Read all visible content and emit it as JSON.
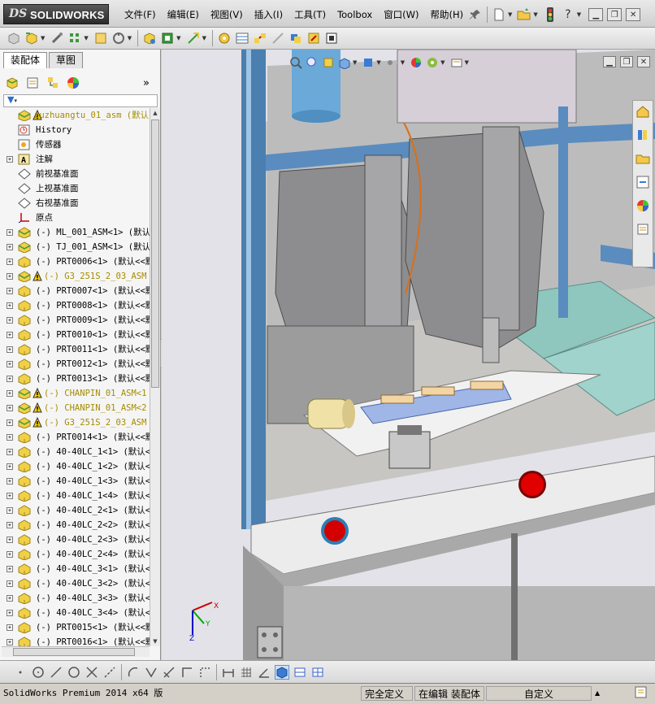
{
  "app": {
    "logo_ds": "DS",
    "logo_name": "SOLIDWORKS"
  },
  "menu": [
    "文件(F)",
    "编辑(E)",
    "视图(V)",
    "插入(I)",
    "工具(T)",
    "Toolbox",
    "窗口(W)",
    "帮助(H)"
  ],
  "panel": {
    "tabs": [
      "装配体",
      "草图"
    ],
    "tree": [
      {
        "label": "zuzhuangtu_01_asm  (默认",
        "expand": "",
        "warn": true,
        "icon": "assembly-icon",
        "top": true
      },
      {
        "label": "History",
        "expand": "",
        "icon": "history-icon"
      },
      {
        "label": "传感器",
        "expand": "",
        "icon": "sensor-icon"
      },
      {
        "label": "注解",
        "expand": "+",
        "icon": "annotation-icon"
      },
      {
        "label": "前视基准面",
        "expand": "",
        "icon": "plane-icon"
      },
      {
        "label": "上视基准面",
        "expand": "",
        "icon": "plane-icon"
      },
      {
        "label": "右视基准面",
        "expand": "",
        "icon": "plane-icon"
      },
      {
        "label": "原点",
        "expand": "",
        "icon": "origin-icon"
      },
      {
        "label": "(-) ML_001_ASM<1> (默认",
        "expand": "+",
        "icon": "subassembly-icon"
      },
      {
        "label": "(-) TJ_001_ASM<1> (默认",
        "expand": "+",
        "icon": "subassembly-icon"
      },
      {
        "label": "(-) PRT0006<1> (默认<<默",
        "expand": "+",
        "icon": "part-icon"
      },
      {
        "label": "(-) G3_251S_2_03_ASM",
        "expand": "+",
        "icon": "subassembly-icon",
        "warn": true
      },
      {
        "label": "(-) PRT0007<1> (默认<<默",
        "expand": "+",
        "icon": "part-icon"
      },
      {
        "label": "(-) PRT0008<1> (默认<<默",
        "expand": "+",
        "icon": "part-icon"
      },
      {
        "label": "(-) PRT0009<1> (默认<<默",
        "expand": "+",
        "icon": "part-icon"
      },
      {
        "label": "(-) PRT0010<1> (默认<<默",
        "expand": "+",
        "icon": "part-icon"
      },
      {
        "label": "(-) PRT0011<1> (默认<<默",
        "expand": "+",
        "icon": "part-icon"
      },
      {
        "label": "(-) PRT0012<1> (默认<<默",
        "expand": "+",
        "icon": "part-icon"
      },
      {
        "label": "(-) PRT0013<1> (默认<<默",
        "expand": "+",
        "icon": "part-icon"
      },
      {
        "label": "(-) CHANPIN_01_ASM<1",
        "expand": "+",
        "icon": "subassembly-icon",
        "warn": true
      },
      {
        "label": "(-) CHANPIN_01_ASM<2",
        "expand": "+",
        "icon": "subassembly-icon",
        "warn": true
      },
      {
        "label": "(-) G3_251S_2_03_ASM",
        "expand": "+",
        "icon": "subassembly-icon",
        "warn": true
      },
      {
        "label": "(-) PRT0014<1> (默认<<默",
        "expand": "+",
        "icon": "part-icon"
      },
      {
        "label": "(-) 40-40LC_1<1> (默认<",
        "expand": "+",
        "icon": "part-icon"
      },
      {
        "label": "(-) 40-40LC_1<2> (默认<",
        "expand": "+",
        "icon": "part-icon"
      },
      {
        "label": "(-) 40-40LC_1<3> (默认<",
        "expand": "+",
        "icon": "part-icon"
      },
      {
        "label": "(-) 40-40LC_1<4> (默认<",
        "expand": "+",
        "icon": "part-icon"
      },
      {
        "label": "(-) 40-40LC_2<1> (默认<",
        "expand": "+",
        "icon": "part-icon"
      },
      {
        "label": "(-) 40-40LC_2<2> (默认<",
        "expand": "+",
        "icon": "part-icon"
      },
      {
        "label": "(-) 40-40LC_2<3> (默认<",
        "expand": "+",
        "icon": "part-icon"
      },
      {
        "label": "(-) 40-40LC_2<4> (默认<",
        "expand": "+",
        "icon": "part-icon"
      },
      {
        "label": "(-) 40-40LC_3<1> (默认<",
        "expand": "+",
        "icon": "part-icon"
      },
      {
        "label": "(-) 40-40LC_3<2> (默认<",
        "expand": "+",
        "icon": "part-icon"
      },
      {
        "label": "(-) 40-40LC_3<3> (默认<",
        "expand": "+",
        "icon": "part-icon"
      },
      {
        "label": "(-) 40-40LC_3<4> (默认<",
        "expand": "+",
        "icon": "part-icon"
      },
      {
        "label": "(-) PRT0015<1> (默认<<默",
        "expand": "+",
        "icon": "part-icon"
      },
      {
        "label": "(-) PRT0016<1> (默认<<默",
        "expand": "+",
        "icon": "part-icon"
      }
    ]
  },
  "triad": {
    "x": "X",
    "y": "Y",
    "z": "Z"
  },
  "status": {
    "product": "SolidWorks Premium 2014 x64 版",
    "definition": "完全定义",
    "mode": "在编辑 装配体",
    "units": "自定义"
  },
  "colors": {
    "accent_yellow": "#a58c00",
    "frame_blue": "#4a7fb0",
    "button_red": "#d40000",
    "panel_teal": "#8fc7bf"
  }
}
